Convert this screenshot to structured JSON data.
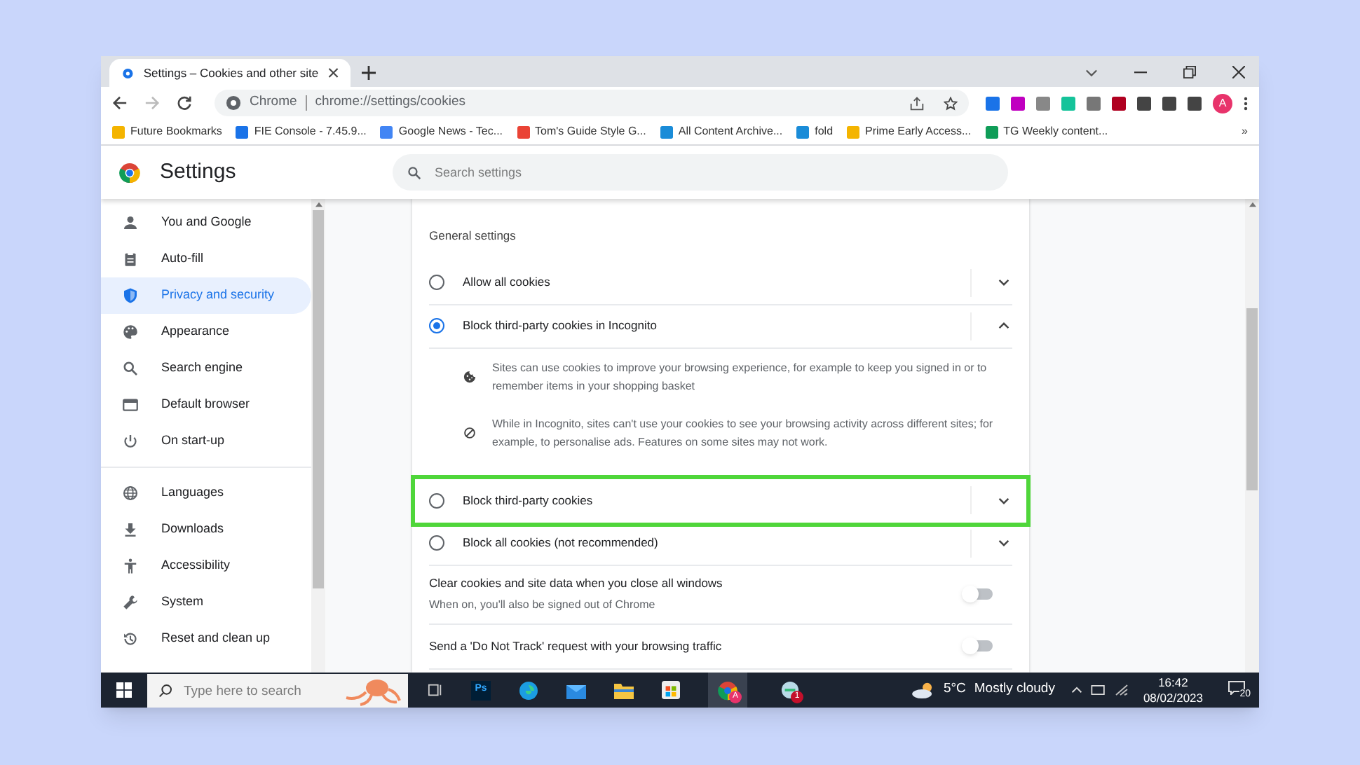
{
  "browser": {
    "tab_title": "Settings – Cookies and other site",
    "site_chip": "Chrome",
    "url": "chrome://settings/cookies",
    "profile_initial": "A",
    "bookmarks_overflow": "»",
    "bookmarks": [
      {
        "label": "Future Bookmarks",
        "color": "#f4b400"
      },
      {
        "label": "FIE Console - 7.45.9...",
        "color": "#1a73e8"
      },
      {
        "label": "Google News - Tec...",
        "color": "#4285f4"
      },
      {
        "label": "Tom's Guide Style G...",
        "color": "#ea4335"
      },
      {
        "label": "All Content Archive...",
        "color": "#1a8cd8"
      },
      {
        "label": "fold",
        "color": "#1a8cd8"
      },
      {
        "label": "Prime Early Access...",
        "color": "#f4b400"
      },
      {
        "label": "TG Weekly content...",
        "color": "#0f9d58"
      }
    ]
  },
  "settings": {
    "title": "Settings",
    "search_placeholder": "Search settings",
    "sidebar": [
      {
        "label": "You and Google",
        "selected": false
      },
      {
        "label": "Auto-fill",
        "selected": false
      },
      {
        "label": "Privacy and security",
        "selected": true
      },
      {
        "label": "Appearance",
        "selected": false
      },
      {
        "label": "Search engine",
        "selected": false
      },
      {
        "label": "Default browser",
        "selected": false
      },
      {
        "label": "On start-up",
        "selected": false
      },
      {
        "label": "Languages",
        "selected": false
      },
      {
        "label": "Downloads",
        "selected": false
      },
      {
        "label": "Accessibility",
        "selected": false
      },
      {
        "label": "System",
        "selected": false
      },
      {
        "label": "Reset and clean up",
        "selected": false
      }
    ],
    "section_title": "General settings",
    "options": [
      {
        "label": "Allow all cookies",
        "selected": false,
        "expanded": false,
        "highlighted": false
      },
      {
        "label": "Block third-party cookies in Incognito",
        "selected": true,
        "expanded": true,
        "highlighted": false,
        "details": [
          "Sites can use cookies to improve your browsing experience, for example to keep you signed in or to remember items in your shopping basket",
          "While in Incognito, sites can't use your cookies to see your browsing activity across different sites; for example, to personalise ads. Features on some sites may not work."
        ]
      },
      {
        "label": "Block third-party cookies",
        "selected": false,
        "expanded": false,
        "highlighted": true
      },
      {
        "label": "Block all cookies (not recommended)",
        "selected": false,
        "expanded": false,
        "highlighted": false
      }
    ],
    "toggles": [
      {
        "label": "Clear cookies and site data when you close all windows",
        "sublabel": "When on, you'll also be signed out of Chrome",
        "on": false
      },
      {
        "label": "Send a 'Do Not Track' request with your browsing traffic",
        "on": false
      }
    ]
  },
  "taskbar": {
    "search_placeholder": "Type here to search",
    "ps_label": "Ps",
    "chrome_badge": "A",
    "app_badge": "1",
    "temperature": "5°C",
    "weather": "Mostly cloudy",
    "time": "16:42",
    "date": "08/02/2023",
    "notifications": "20"
  }
}
